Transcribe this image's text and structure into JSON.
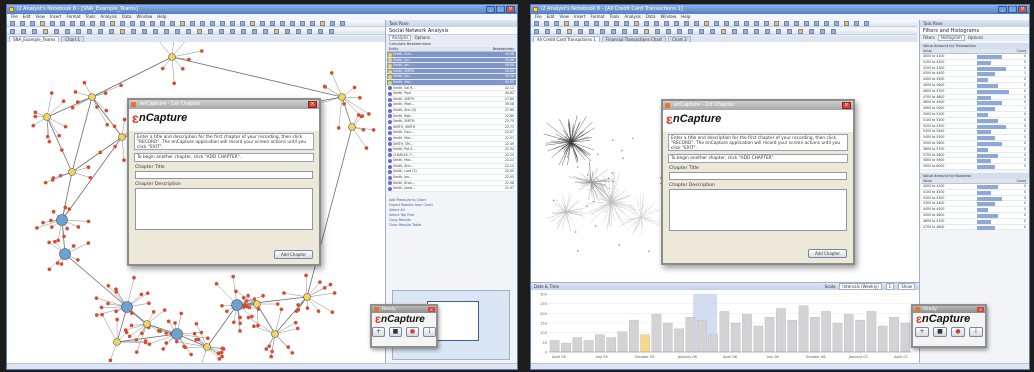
{
  "left_window": {
    "title": "i2 Analyst's Notebook 8 - [SNA_Example_Teams]",
    "menu": [
      "File",
      "Edit",
      "View",
      "Insert",
      "Format",
      "Tools",
      "Analysis",
      "Data",
      "Window",
      "Help"
    ],
    "tabs": [
      "SNA_Example_Teams",
      "Chart 1"
    ],
    "side_pane": {
      "header": "Task Pane",
      "title": "Social Network Analysis",
      "tabs": [
        "Analysis",
        "Options"
      ],
      "action": "Calculate Betweenness",
      "columns": [
        "Entity",
        "Betweenness"
      ],
      "rows": [
        {
          "name": "Smith, Ann...",
          "value": "45.98",
          "selected": true
        },
        {
          "name": "Smith, Jan...",
          "value": "45.88",
          "selected": true
        },
        {
          "name": "Smith, Jac...",
          "value": "45.68",
          "selected": true
        },
        {
          "name": "Smith, SMITH",
          "value": "45.60",
          "selected": true
        },
        {
          "name": "Smith, Jon...",
          "value": "45.58",
          "selected": true
        },
        {
          "name": "Smith, Mar...",
          "value": "45.05",
          "selected": true
        },
        {
          "name": "Smith, Sal R...",
          "value": "42.12",
          "selected": false
        },
        {
          "name": "Smith, Paul",
          "value": "40.62",
          "selected": false
        },
        {
          "name": "Smith, SMITH",
          "value": "27.80",
          "selected": false
        },
        {
          "name": "Smith, Mae...",
          "value": "39.58",
          "selected": false
        },
        {
          "name": "Smith, Ann (S)",
          "value": "27.80",
          "selected": false
        },
        {
          "name": "Smith, Rob...",
          "value": "22.80",
          "selected": false
        },
        {
          "name": "Smith, SMITH",
          "value": "23.75",
          "selected": false
        },
        {
          "name": "SMITH, SMITH",
          "value": "22.73",
          "selected": false
        },
        {
          "name": "Smith, Dou...",
          "value": "22.57",
          "selected": false
        },
        {
          "name": "Smith, Mar...",
          "value": "22.57",
          "selected": false
        },
        {
          "name": "SMITH, SM...",
          "value": "22.49",
          "selected": false
        },
        {
          "name": "Smith, Pat S...",
          "value": "22.34",
          "selected": false
        },
        {
          "name": "CHARLES, T...",
          "value": "22.25",
          "selected": false
        },
        {
          "name": "Smith, Mar...",
          "value": "22.21",
          "selected": false
        },
        {
          "name": "Smith, Ann...",
          "value": "22.14",
          "selected": false
        },
        {
          "name": "Smith, Lora (S)",
          "value": "22.05",
          "selected": false
        },
        {
          "name": "Smith, Jon...",
          "value": "22.05",
          "selected": false
        },
        {
          "name": "Smith, Bran...",
          "value": "21.98",
          "selected": false
        },
        {
          "name": "Smith, Jame...",
          "value": "21.97",
          "selected": false
        }
      ],
      "links": [
        "Add Measure to Chart",
        "Export Results from Chart",
        "Select All",
        "Select Top Five",
        "Copy Results",
        "Clear Results Table"
      ]
    },
    "dialog": {
      "title": "enCapture - 1st Chapter",
      "brand": "nCapture",
      "instructions": "Enter a title and description for the first chapter of your recording, then click \"RECORD\". The enCapture application will record your screen actions until you click \"EXIT\".",
      "hint": "To begin another chapter, click \"ADD CHAPTER\".",
      "chapter_title_label": "Chapter Title",
      "chapter_description_label": "Chapter Description",
      "button": "Add Chapter"
    }
  },
  "right_window": {
    "title": "i2 Analyst's Notebook 8 - [All Credit Card Transactions 1]",
    "menu": [
      "File",
      "Edit",
      "View",
      "Insert",
      "Format",
      "Tools",
      "Analysis",
      "Data",
      "Window",
      "Help"
    ],
    "tabs": [
      "All Credit Card Transactions 1",
      "Financial Transactions Chart",
      "Chart 2"
    ],
    "side_pane": {
      "header": "Task Pane",
      "title": "Filters and Histograms",
      "tabs": [
        "Filters",
        "Histogram",
        "Options"
      ],
      "histogram1_header": "Value Amount for Transaction",
      "histogram2_header": "Value Amount for Business",
      "columns": [
        "Value",
        "Count"
      ],
      "hist1_rows": [
        {
          "label": "4000 to 4100",
          "value": 0.7,
          "count": "0"
        },
        {
          "label": "4100 to 4200",
          "value": 0.4,
          "count": "0"
        },
        {
          "label": "4200 to 4300",
          "value": 0.8,
          "count": "0"
        },
        {
          "label": "4300 to 4400",
          "value": 0.5,
          "count": "1"
        },
        {
          "label": "4400 to 4500",
          "value": 0.3,
          "count": "0"
        },
        {
          "label": "4500 to 4600",
          "value": 0.6,
          "count": "0"
        },
        {
          "label": "4600 to 4700",
          "value": 0.9,
          "count": "0"
        },
        {
          "label": "4700 to 4800",
          "value": 0.4,
          "count": "0"
        },
        {
          "label": "4800 to 4900",
          "value": 0.7,
          "count": "0"
        },
        {
          "label": "4900 to 5000",
          "value": 0.5,
          "count": "1"
        },
        {
          "label": "5000 to 5100",
          "value": 0.3,
          "count": "0"
        },
        {
          "label": "5100 to 5200",
          "value": 0.6,
          "count": "0"
        },
        {
          "label": "5200 to 5300",
          "value": 0.8,
          "count": "0"
        },
        {
          "label": "5300 to 5400",
          "value": 0.4,
          "count": "0"
        },
        {
          "label": "5400 to 5500",
          "value": 0.5,
          "count": "0"
        },
        {
          "label": "5500 to 5600",
          "value": 0.7,
          "count": "0"
        },
        {
          "label": "5600 to 5700",
          "value": 0.3,
          "count": "0"
        },
        {
          "label": "5700 to 5800",
          "value": 0.6,
          "count": "0"
        },
        {
          "label": "5800 to 5900",
          "value": 0.4,
          "count": "0"
        },
        {
          "label": "5900 to 6000",
          "value": 0.5,
          "count": "0"
        }
      ],
      "hist2_rows": [
        {
          "label": "4000 to 4100",
          "value": 0.6,
          "count": "0"
        },
        {
          "label": "4100 to 4200",
          "value": 0.4,
          "count": "0"
        },
        {
          "label": "4200 to 4300",
          "value": 0.7,
          "count": "0"
        },
        {
          "label": "4300 to 4400",
          "value": 0.5,
          "count": "0"
        },
        {
          "label": "4400 to 4500",
          "value": 0.3,
          "count": "0"
        },
        {
          "label": "4500 to 4600",
          "value": 0.6,
          "count": "0"
        },
        {
          "label": "4600 to 4700",
          "value": 0.4,
          "count": "0"
        },
        {
          "label": "4700 to 4800",
          "value": 0.5,
          "count": "0"
        }
      ]
    },
    "timeline": {
      "header": "Date & Time",
      "controls": [
        "Scale",
        "Intervals (Weekly)",
        "1",
        "Show"
      ],
      "months": [
        "April 05",
        "July 05",
        "October 05",
        "January 06",
        "April 06",
        "July 06",
        "October 06",
        "January 07",
        "April 07"
      ],
      "yticks": [
        "300",
        "250",
        "200",
        "150",
        "100",
        "50",
        "0"
      ],
      "bars": [
        0.2,
        0.15,
        0.25,
        0.2,
        0.3,
        0.25,
        0.35,
        0.55,
        0.3,
        0.65,
        0.5,
        0.4,
        0.6,
        0.55,
        0.3,
        0.7,
        0.5,
        0.65,
        0.45,
        0.6,
        0.75,
        0.55,
        0.8,
        0.6,
        0.7,
        0.5,
        0.65,
        0.55,
        0.7,
        0.45,
        0.6,
        0.5
      ]
    },
    "dialog": {
      "title": "enCapture - 1st Chapter",
      "brand": "nCapture",
      "instructions": "Enter a title and description for the first chapter of your recording, then click \"RECORD\". The enCapture application will record your screen actions until you click \"EXIT\".",
      "hint": "To begin another chapter, click \"ADD CHAPTER\".",
      "chapter_title_label": "Chapter Title",
      "chapter_description_label": "Chapter Description",
      "button": "Add Chapter"
    }
  },
  "ready_widget": {
    "title": "Ready",
    "brand": "nCapture",
    "buttons": [
      {
        "name": "add",
        "icon": "plus-icon",
        "glyph": "+"
      },
      {
        "name": "stop",
        "icon": "stop-icon",
        "glyph": "■"
      },
      {
        "name": "record",
        "icon": "record-icon",
        "glyph": "●"
      },
      {
        "name": "info",
        "icon": "info-icon",
        "glyph": "i"
      }
    ]
  },
  "colors": {
    "node_yellow": "#f3d35a",
    "node_red": "#d84a2e",
    "node_blue": "#6fa0d4",
    "brand_red": "#d2402c",
    "timeline_highlight": "#f8d98a"
  }
}
